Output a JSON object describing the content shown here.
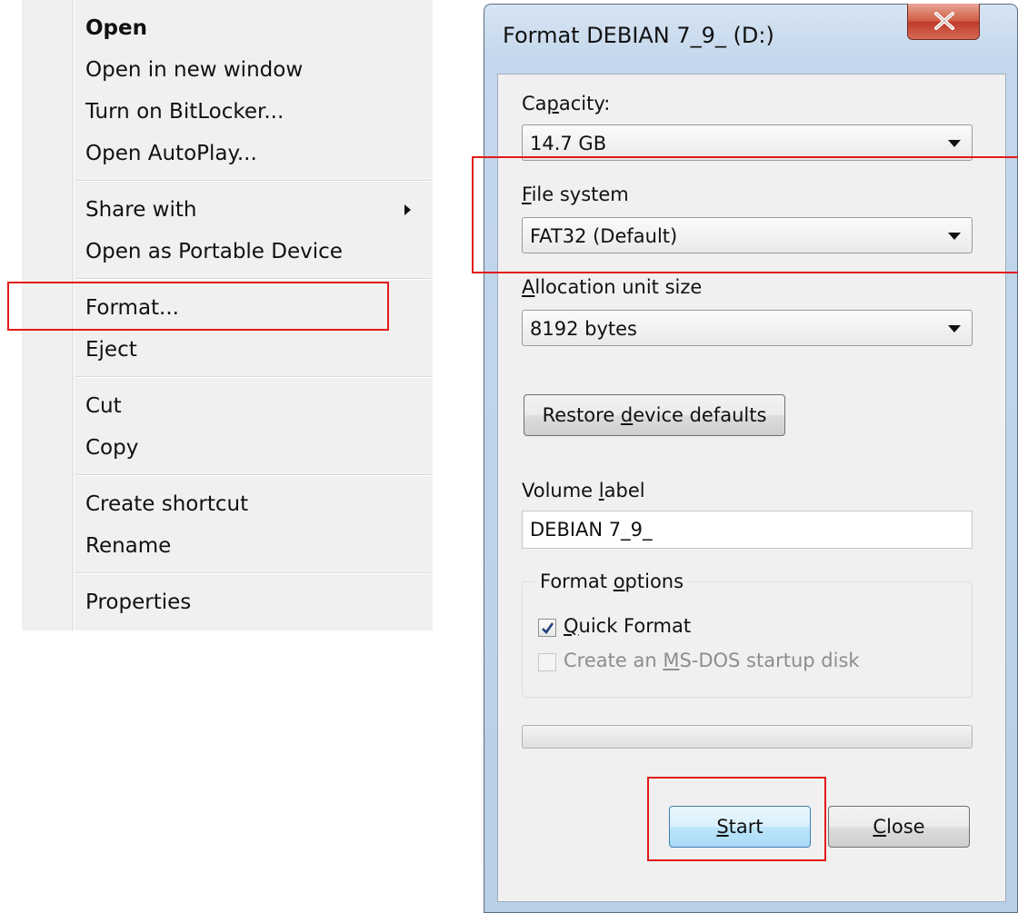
{
  "context_menu": {
    "groups": [
      [
        {
          "label": "Open",
          "bold": true
        },
        {
          "label": "Open in new window"
        },
        {
          "label": "Turn on BitLocker..."
        },
        {
          "label": "Open AutoPlay..."
        }
      ],
      [
        {
          "label": "Share with",
          "submenu": true
        },
        {
          "label": "Open as Portable Device"
        }
      ],
      [
        {
          "label": "Format..."
        },
        {
          "label": "Eject"
        }
      ],
      [
        {
          "label": "Cut"
        },
        {
          "label": "Copy"
        }
      ],
      [
        {
          "label": "Create shortcut"
        },
        {
          "label": "Rename"
        }
      ],
      [
        {
          "label": "Properties"
        }
      ]
    ]
  },
  "dialog": {
    "title": "Format DEBIAN 7_9_ (D:)",
    "capacity": {
      "label_pre": "Ca",
      "label_key": "p",
      "label_post": "acity:",
      "value": "14.7 GB"
    },
    "file_system": {
      "label_key": "F",
      "label_post": "ile system",
      "value": "FAT32 (Default)"
    },
    "allocation": {
      "label_key": "A",
      "label_post": "llocation unit size",
      "value": "8192 bytes"
    },
    "restore_button": {
      "pre": "Restore ",
      "key": "d",
      "post": "evice defaults"
    },
    "volume_label": {
      "pre": "Volume ",
      "key": "l",
      "post": "abel",
      "value": "DEBIAN 7_9_"
    },
    "format_options": {
      "legend_pre": "Format ",
      "legend_key": "o",
      "legend_post": "ptions",
      "quick_format": {
        "key": "Q",
        "post": "uick Format",
        "checked": true
      },
      "msdos": {
        "pre": "Create an ",
        "key": "M",
        "post": "S-DOS startup disk",
        "checked": false,
        "enabled": false
      }
    },
    "progress": 0,
    "start_button": {
      "key": "S",
      "post": "tart"
    },
    "close_button": {
      "key": "C",
      "post": "lose"
    }
  },
  "colors": {
    "highlight": "#e21a1a",
    "title_bar": "#c4d7ec",
    "close_button": "#c0392b"
  }
}
